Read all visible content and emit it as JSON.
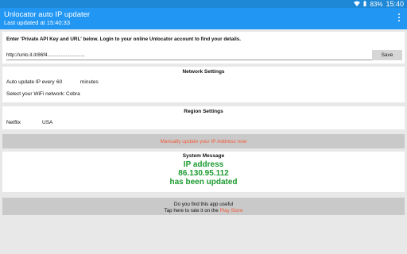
{
  "status": {
    "battery": "83%",
    "time": "15:40",
    "wifi_icon": "wifi-icon",
    "battery_icon": "battery-icon"
  },
  "appbar": {
    "title": "Unlocator auto IP updater",
    "subtitle": "Last updated at 15:40:33",
    "menu_icon": "overflow-menu-icon"
  },
  "api": {
    "instruction": "Enter 'Private API Key and URL' below. Login to your online Unlocator account to find your details.",
    "url_value": "http://unlo.it.it/86f4...........................",
    "save_label": "Save"
  },
  "network": {
    "title": "Network Settings",
    "interval_label": "Auto update IP every",
    "interval_value": "60",
    "interval_unit": "minutes",
    "wifi_label": "Select your WiFi network:",
    "wifi_value": "Cobra"
  },
  "region": {
    "title": "Region Settings",
    "service": "Netflix",
    "country": "USA"
  },
  "manual_button": "Manually update your IP Address now",
  "system": {
    "title": "System Message",
    "line1": "IP address",
    "line2": "86.130.95.112",
    "line3": "has been updated"
  },
  "rate": {
    "line1": "Do you find this app useful",
    "line2_prefix": "Tap here to rate it on the",
    "store": "Play Store"
  },
  "colors": {
    "appbar": "#2196f3",
    "accent_orange": "#f25c3b",
    "success_green": "#1b9a2f"
  }
}
